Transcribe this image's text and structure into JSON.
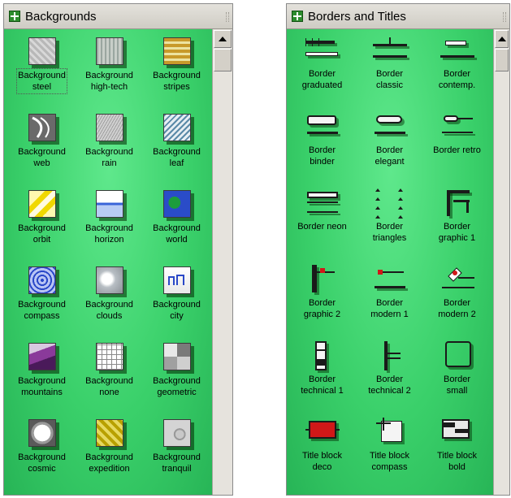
{
  "left_panel": {
    "title": "Backgrounds",
    "items": [
      {
        "line1": "Background",
        "line2": "steel",
        "icon": "steel-texture-icon",
        "selected": true
      },
      {
        "line1": "Background",
        "line2": "high-tech",
        "icon": "high-tech-texture-icon"
      },
      {
        "line1": "Background",
        "line2": "stripes",
        "icon": "stripes-texture-icon"
      },
      {
        "line1": "Background",
        "line2": "web",
        "icon": "web-texture-icon"
      },
      {
        "line1": "Background",
        "line2": "rain",
        "icon": "rain-texture-icon"
      },
      {
        "line1": "Background",
        "line2": "leaf",
        "icon": "leaf-texture-icon"
      },
      {
        "line1": "Background",
        "line2": "orbit",
        "icon": "orbit-texture-icon"
      },
      {
        "line1": "Background",
        "line2": "horizon",
        "icon": "horizon-texture-icon"
      },
      {
        "line1": "Background",
        "line2": "world",
        "icon": "world-texture-icon"
      },
      {
        "line1": "Background",
        "line2": "compass",
        "icon": "compass-texture-icon"
      },
      {
        "line1": "Background",
        "line2": "clouds",
        "icon": "clouds-texture-icon"
      },
      {
        "line1": "Background",
        "line2": "city",
        "icon": "city-texture-icon"
      },
      {
        "line1": "Background",
        "line2": "mountains",
        "icon": "mountains-texture-icon"
      },
      {
        "line1": "Background",
        "line2": "none",
        "icon": "grid-texture-icon"
      },
      {
        "line1": "Background",
        "line2": "geometric",
        "icon": "geometric-texture-icon"
      },
      {
        "line1": "Background",
        "line2": "cosmic",
        "icon": "cosmic-texture-icon"
      },
      {
        "line1": "Background",
        "line2": "expedition",
        "icon": "expedition-texture-icon"
      },
      {
        "line1": "Background",
        "line2": "tranquil",
        "icon": "tranquil-texture-icon"
      }
    ]
  },
  "right_panel": {
    "title": "Borders and Titles",
    "items": [
      {
        "line1": "Border",
        "line2": "graduated",
        "icon": "border-graduated-icon"
      },
      {
        "line1": "Border",
        "line2": "classic",
        "icon": "border-classic-icon"
      },
      {
        "line1": "Border",
        "line2": "contemp.",
        "icon": "border-contemporary-icon"
      },
      {
        "line1": "Border",
        "line2": "binder",
        "icon": "border-binder-icon"
      },
      {
        "line1": "Border",
        "line2": "elegant",
        "icon": "border-elegant-icon"
      },
      {
        "line1": "Border retro",
        "line2": "",
        "icon": "border-retro-icon"
      },
      {
        "line1": "Border neon",
        "line2": "",
        "icon": "border-neon-icon"
      },
      {
        "line1": "Border",
        "line2": "triangles",
        "icon": "border-triangles-icon"
      },
      {
        "line1": "Border",
        "line2": "graphic 1",
        "icon": "border-graphic-1-icon"
      },
      {
        "line1": "Border",
        "line2": "graphic 2",
        "icon": "border-graphic-2-icon"
      },
      {
        "line1": "Border",
        "line2": "modern 1",
        "icon": "border-modern-1-icon"
      },
      {
        "line1": "Border",
        "line2": "modern 2",
        "icon": "border-modern-2-icon"
      },
      {
        "line1": "Border",
        "line2": "technical 1",
        "icon": "border-technical-1-icon"
      },
      {
        "line1": "Border",
        "line2": "technical 2",
        "icon": "border-technical-2-icon"
      },
      {
        "line1": "Border",
        "line2": "small",
        "icon": "border-small-icon"
      },
      {
        "line1": "Title block",
        "line2": "deco",
        "icon": "title-block-deco-icon"
      },
      {
        "line1": "Title block",
        "line2": "compass",
        "icon": "title-block-compass-icon"
      },
      {
        "line1": "Title block",
        "line2": "bold",
        "icon": "title-block-bold-icon"
      }
    ]
  },
  "colors": {
    "stencil_green": "#3ad06a",
    "title_icon_green": "#2c8c2c",
    "accent_red": "#d01818"
  }
}
